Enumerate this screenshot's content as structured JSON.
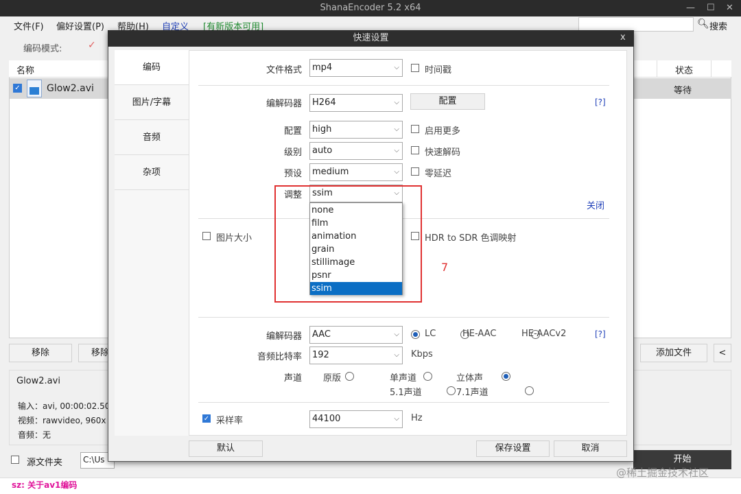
{
  "app": {
    "title": "ShanaEncoder 5.2 x64"
  },
  "window_controls": {
    "minimize": "—",
    "maximize": "☐",
    "close": "✕"
  },
  "menu": [
    "文件(F)",
    "偏好设置(P)",
    "帮助(H)",
    "自定义",
    "[有新版本可用]"
  ],
  "colors": {
    "menu_custom": "#1f3fb8",
    "menu_update": "#1e8a2e",
    "accent": "#0b6ec4",
    "redbox": "#e03030",
    "status_text": "#e0149a",
    "red_number": "#e03030"
  },
  "search": {
    "label": "搜索",
    "value": ""
  },
  "mode": {
    "label": "编码模式:"
  },
  "list": {
    "headers": {
      "name": "名称",
      "status": "状态"
    },
    "rows": [
      {
        "name": "Glow2.avi",
        "status": "等待"
      }
    ]
  },
  "bottom_buttons": {
    "remove": "移除",
    "remove2": "移除",
    "add_file": "添加文件",
    "arrow": "<"
  },
  "info": {
    "filename": "Glow2.avi",
    "input": "输入：avi, 00:00:02.50",
    "video": "视频：rawvideo, 960x",
    "audio": "音频：无"
  },
  "source_folder": {
    "label": "源文件夹",
    "path": "C:\\Us"
  },
  "start": "开始",
  "status": {
    "text": "sz: 关于av1编码"
  },
  "watermark": "@稀土掘金技术社区",
  "dialog": {
    "title": "快速设置",
    "close": "x",
    "tabs": [
      "编码",
      "图片/字幕",
      "音频",
      "杂项"
    ],
    "format": {
      "label": "文件格式",
      "value": "mp4",
      "timestamp": "时间戳"
    },
    "video": {
      "codec_label": "编解码器",
      "codec": "H264",
      "config_btn": "配置",
      "help": "[?]",
      "profile_label": "配置",
      "profile": "high",
      "more": "启用更多",
      "level_label": "级别",
      "level": "auto",
      "fast_decode": "快速解码",
      "preset_label": "预设",
      "preset": "medium",
      "zero_latency": "零延迟",
      "tune_label": "调整",
      "tune": "ssim",
      "close_link": "关闭"
    },
    "tune_options": [
      "none",
      "film",
      "animation",
      "grain",
      "stillimage",
      "psnr",
      "ssim"
    ],
    "tune_selected": "ssim",
    "picture_size": "图片大小",
    "hdr": "HDR to SDR 色调映射",
    "annotation": "7",
    "audio": {
      "codec_label": "编解码器",
      "codec": "AAC",
      "lc": "LC",
      "he": "HE-AAC",
      "hev2": "HE-AACv2",
      "help": "[?]",
      "bitrate_label": "音频比特率",
      "bitrate": "192",
      "bitrate_unit": "Kbps",
      "channel_label": "声道",
      "original": "原版",
      "mono": "单声道",
      "stereo": "立体声",
      "ch51": "5.1声道",
      "ch71": "7.1声道",
      "samplerate_label": "采样率",
      "samplerate": "44100",
      "samplerate_unit": "Hz"
    },
    "buttons": {
      "default": "默认",
      "save": "保存设置",
      "cancel": "取消"
    }
  }
}
